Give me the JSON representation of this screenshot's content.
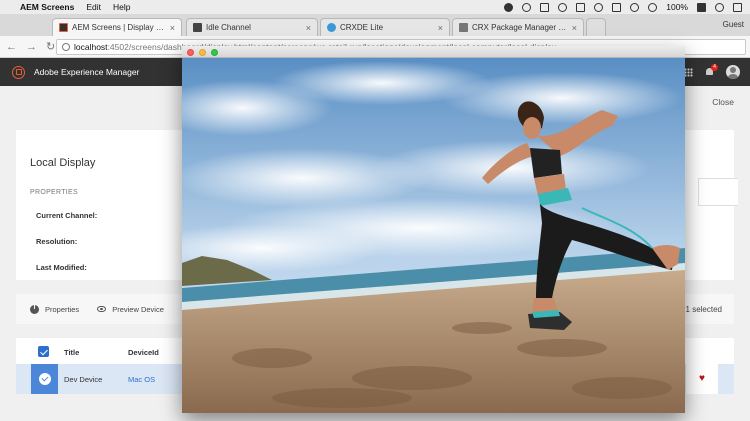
{
  "menubar": {
    "apple": "",
    "app_name": "AEM Screens",
    "menus": [
      "Edit",
      "Help"
    ],
    "battery": "100%",
    "user": "Guest"
  },
  "browser": {
    "tabs": [
      {
        "label": "AEM Screens | Display Dashbo",
        "active": true
      },
      {
        "label": "Idle Channel",
        "active": false
      },
      {
        "label": "CRXDE Lite",
        "active": false
      },
      {
        "label": "CRX Package Manager - /etc/p",
        "active": false
      }
    ],
    "tab_close": "×",
    "url_host": "localhost",
    "url_path": ":4502/screens/dashboard/display.html/content/screens/we-retail-run/locations/development/local-computer/local-display"
  },
  "aem": {
    "brand": "Adobe Experience Manager",
    "notification_count": "4",
    "close_label": "Close"
  },
  "display": {
    "title": "Local Display",
    "properties_heading": "PROPERTIES",
    "properties": [
      "Current Channel:",
      "Resolution:",
      "Last Modified:"
    ]
  },
  "actions": {
    "items": [
      "Properties",
      "Preview Device"
    ],
    "selected_count": "1 selected"
  },
  "table": {
    "headers": [
      "Title",
      "DeviceId"
    ],
    "rows": [
      {
        "title": "Dev Device",
        "device_id": "Mac OS"
      }
    ]
  },
  "popup": {
    "colors": {
      "sky": "#6b9fd0",
      "sand": "#b08a68",
      "sea": "#4a95b0",
      "accent": "#39b8b7"
    }
  }
}
